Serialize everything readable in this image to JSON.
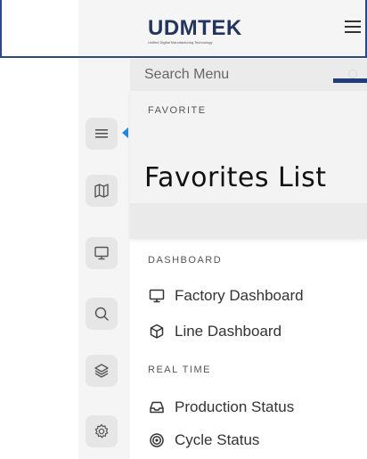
{
  "header": {
    "logo_text": "UDMTEK",
    "logo_subtitle": "Unified Digital Manufacturing Technology",
    "menu_icon": "hamburger-menu-icon"
  },
  "rail": {
    "items": [
      {
        "icon": "list-icon",
        "active": true
      },
      {
        "icon": "map-icon"
      },
      {
        "icon": "monitor-icon"
      },
      {
        "icon": "search-icon"
      },
      {
        "icon": "layers-icon"
      },
      {
        "icon": "gear-icon"
      }
    ],
    "active_color": "#1e88e5"
  },
  "search": {
    "placeholder": "Search Menu"
  },
  "favorite": {
    "header": "FAVORITE",
    "title": "Favorites List"
  },
  "dashboard": {
    "header": "DASHBOARD",
    "items": [
      {
        "label": "Factory Dashboard",
        "icon": "monitor-icon"
      },
      {
        "label": "Line Dashboard",
        "icon": "cube-icon"
      }
    ]
  },
  "realtime": {
    "header": "REAL TIME",
    "items": [
      {
        "label": "Production Status",
        "icon": "inbox-icon"
      },
      {
        "label": "Cycle Status",
        "icon": "target-icon"
      }
    ]
  },
  "colors": {
    "brand": "#22345f",
    "frame": "#2d4a86"
  }
}
